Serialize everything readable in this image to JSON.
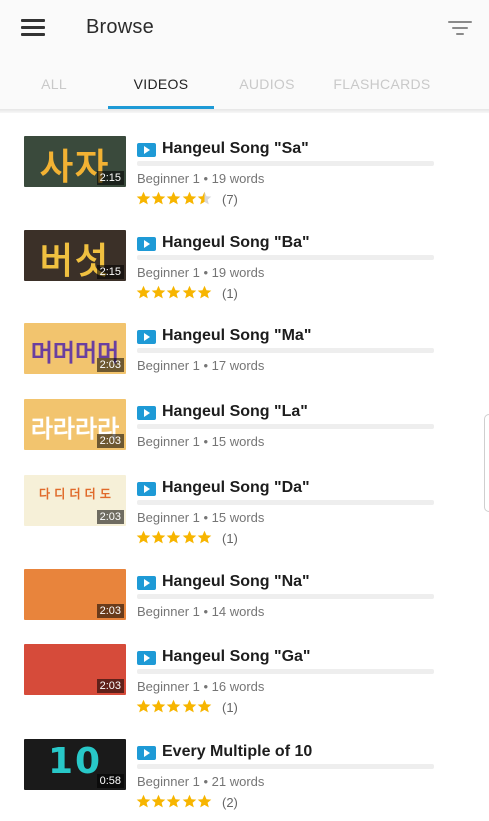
{
  "header": {
    "title": "Browse",
    "menu_icon": "hamburger-menu-icon",
    "filter_icon": "filter-icon"
  },
  "tabs": [
    {
      "label": "ALL",
      "active": false
    },
    {
      "label": "VIDEOS",
      "active": true
    },
    {
      "label": "AUDIOS",
      "active": false
    },
    {
      "label": "FLASHCARDS",
      "active": false
    }
  ],
  "colors": {
    "accent": "#1e9ad6",
    "star": "#f7b500"
  },
  "items": [
    {
      "title": "Hangeul Song \"Sa\"",
      "meta": "Beginner 1 • 19 words",
      "duration": "2:15",
      "rating": 4.5,
      "ratings_count": "(7)",
      "thumb_text": "사자",
      "thumb_bg": "#3a4a3c",
      "thumb_fg": "#f2b233"
    },
    {
      "title": "Hangeul Song \"Ba\"",
      "meta": "Beginner 1 • 19 words",
      "duration": "2:15",
      "rating": 5,
      "ratings_count": "(1)",
      "thumb_text": "버섯",
      "thumb_bg": "#3b3028",
      "thumb_fg": "#f0c040"
    },
    {
      "title": "Hangeul Song \"Ma\"",
      "meta": "Beginner 1 • 17 words",
      "duration": "2:03",
      "rating": null,
      "ratings_count": "",
      "thumb_text": "머머머머",
      "thumb_bg": "#f2c46e",
      "thumb_fg": "#6a3fa0"
    },
    {
      "title": "Hangeul Song \"La\"",
      "meta": "Beginner 1 • 15 words",
      "duration": "2:03",
      "rating": null,
      "ratings_count": "",
      "thumb_text": "라라라라",
      "thumb_bg": "#f2c46e",
      "thumb_fg": "#ffffff"
    },
    {
      "title": "Hangeul Song \"Da\"",
      "meta": "Beginner 1 • 15 words",
      "duration": "2:03",
      "rating": 5,
      "ratings_count": "(1)",
      "thumb_text": "다 디 더 더 도",
      "thumb_bg": "#f6f0d8",
      "thumb_fg": "#e06a2a"
    },
    {
      "title": "Hangeul Song \"Na\"",
      "meta": "Beginner 1 • 14 words",
      "duration": "2:03",
      "rating": null,
      "ratings_count": "",
      "thumb_text": "",
      "thumb_bg": "#e8843c",
      "thumb_fg": "#ffffff"
    },
    {
      "title": "Hangeul Song \"Ga\"",
      "meta": "Beginner 1 • 16 words",
      "duration": "2:03",
      "rating": 5,
      "ratings_count": "(1)",
      "thumb_text": "",
      "thumb_bg": "#d64b3a",
      "thumb_fg": "#ffffff"
    },
    {
      "title": "Every Multiple of 10",
      "meta": "Beginner 1 • 21 words",
      "duration": "0:58",
      "rating": 5,
      "ratings_count": "(2)",
      "thumb_text": "10",
      "thumb_bg": "#1a1a1a",
      "thumb_fg": "#28c8c8"
    }
  ]
}
